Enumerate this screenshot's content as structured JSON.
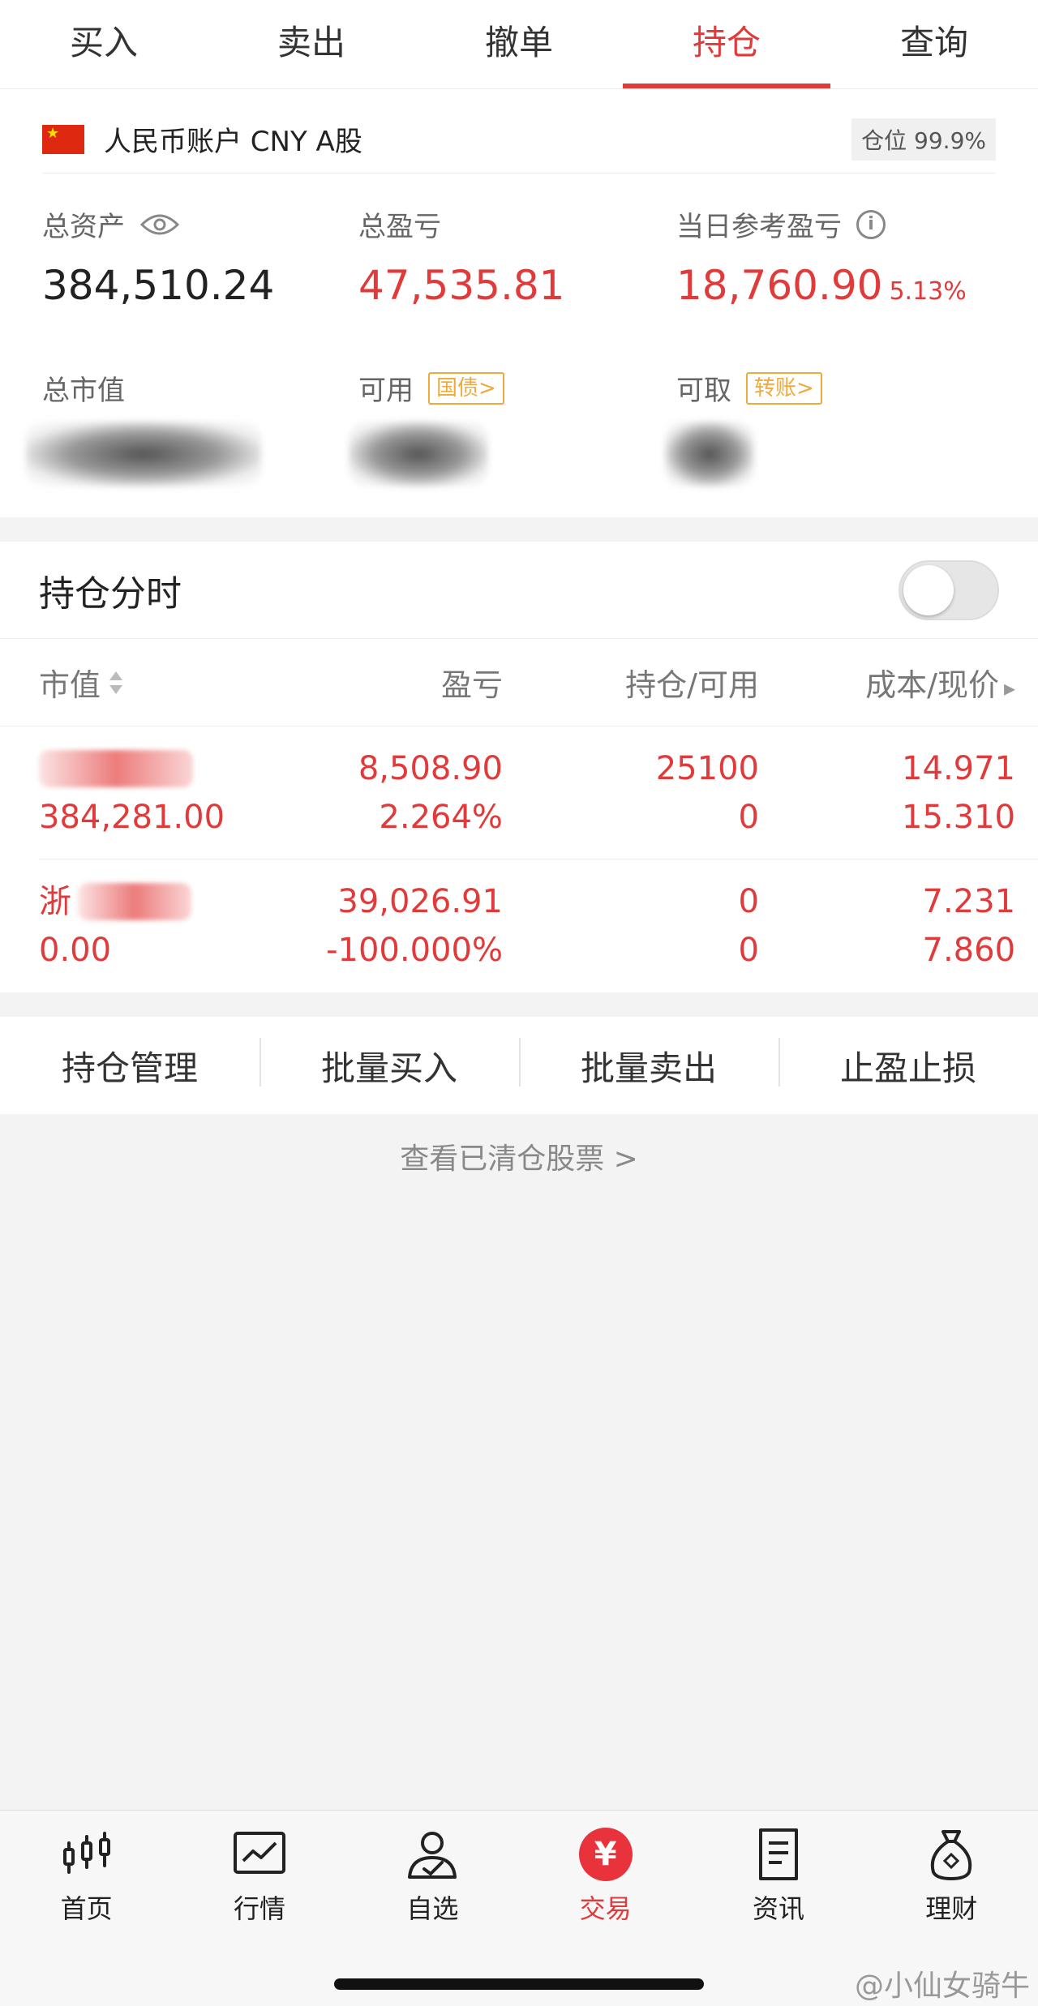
{
  "tabs": [
    {
      "label": "买入"
    },
    {
      "label": "卖出"
    },
    {
      "label": "撤单"
    },
    {
      "label": "持仓",
      "active": true
    },
    {
      "label": "查询"
    }
  ],
  "account": {
    "name": "人民币账户 CNY A股",
    "position_badge": "仓位 99.9%",
    "flag_icon": "china-flag-icon",
    "total_assets_label": "总资产",
    "total_assets": "384,510.24",
    "total_pl_label": "总盈亏",
    "total_pl": "47,535.81",
    "daily_pl_label": "当日参考盈亏",
    "daily_pl": "18,760.90",
    "daily_pl_pct": "5.13%",
    "market_value_label": "总市值",
    "available_label": "可用",
    "available_tag": "国债>",
    "withdrawable_label": "可取",
    "withdrawable_tag": "转账>"
  },
  "holdings": {
    "title": "持仓分时",
    "toggle_on": false,
    "columns": [
      "市值",
      "盈亏",
      "持仓/可用",
      "成本/现价"
    ],
    "rows": [
      {
        "name": "",
        "market_value": "384,281.00",
        "pl": "8,508.90",
        "pl_pct": "2.264%",
        "position": "25100",
        "available": "0",
        "cost": "14.971",
        "price": "15.310"
      },
      {
        "name": "浙",
        "market_value": "0.00",
        "pl": "39,026.91",
        "pl_pct": "-100.000%",
        "position": "0",
        "available": "0",
        "cost": "7.231",
        "price": "7.860"
      }
    ]
  },
  "actions": [
    "持仓管理",
    "批量买入",
    "批量卖出",
    "止盈止损"
  ],
  "cleared_link": "查看已清仓股票 >",
  "bottom_nav": [
    {
      "label": "首页",
      "icon": "candlestick-icon"
    },
    {
      "label": "行情",
      "icon": "chart-icon"
    },
    {
      "label": "自选",
      "icon": "user-check-icon"
    },
    {
      "label": "交易",
      "icon": "yen-icon",
      "active": true
    },
    {
      "label": "资讯",
      "icon": "document-icon"
    },
    {
      "label": "理财",
      "icon": "money-bag-icon"
    }
  ],
  "watermark": "@小仙女骑牛",
  "colors": {
    "accent": "#e03a3a",
    "tag": "#f2a93b"
  }
}
